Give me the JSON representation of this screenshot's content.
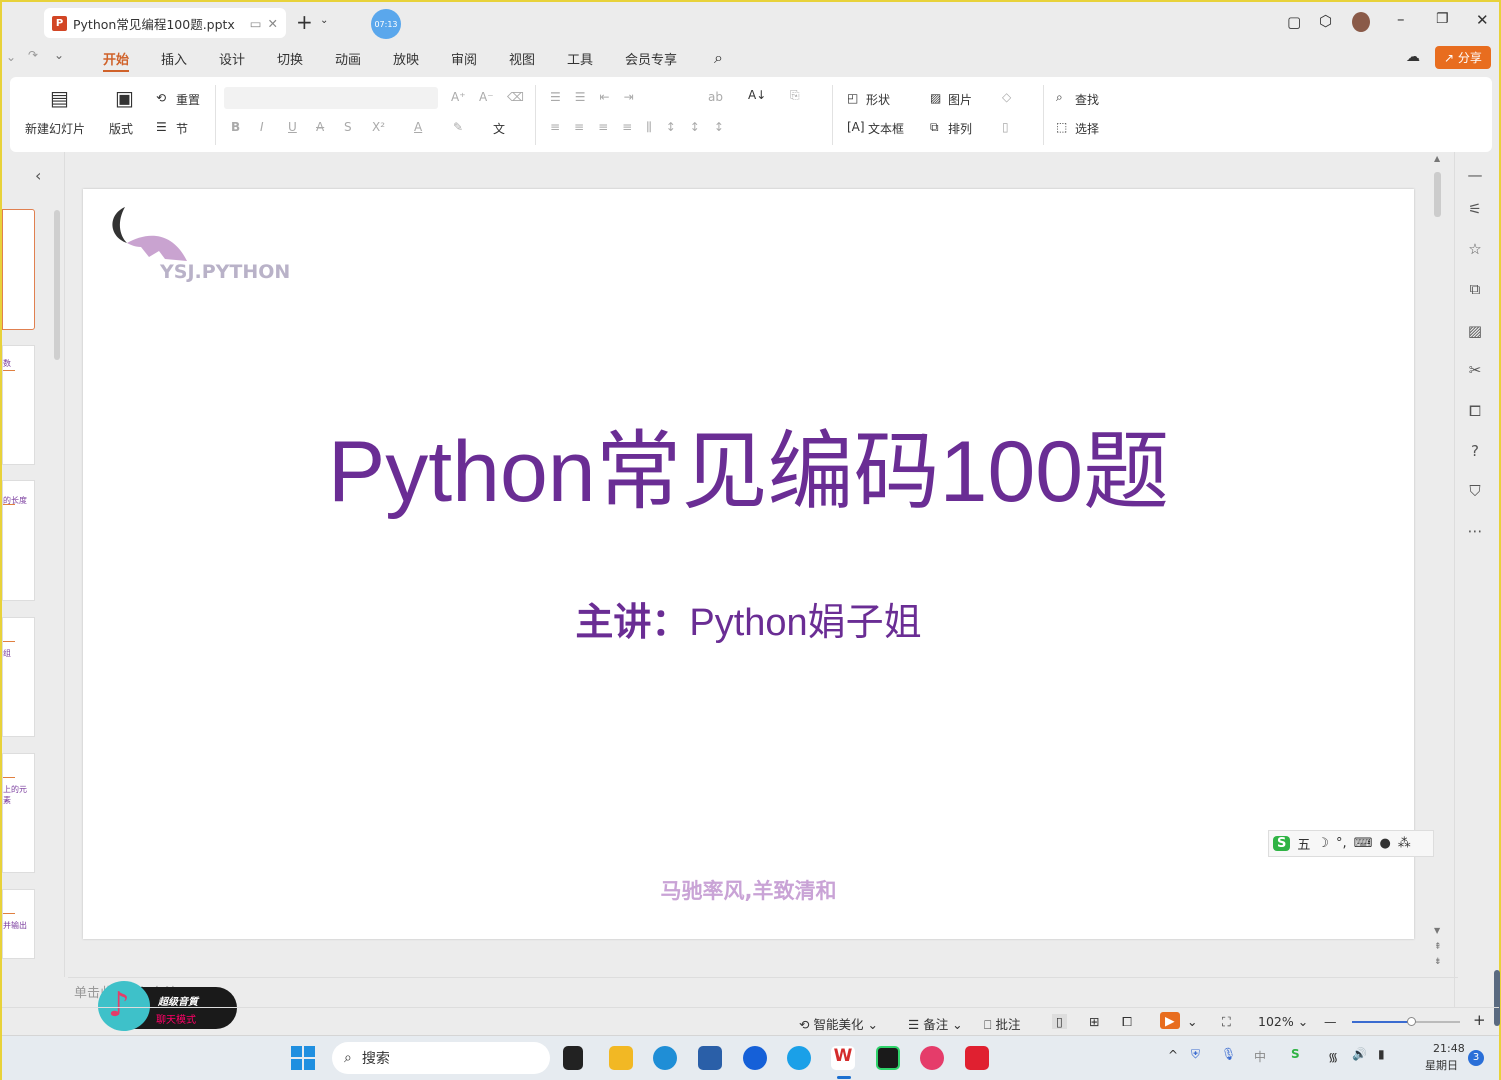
{
  "window": {
    "tab_title": "Python常见编程100题.pptx",
    "timer": "07:13",
    "new_tab": "+"
  },
  "menu": {
    "items": [
      "开始",
      "插入",
      "设计",
      "切换",
      "动画",
      "放映",
      "审阅",
      "视图",
      "工具",
      "会员专享"
    ],
    "active": "开始",
    "share_label": "分享"
  },
  "ribbon": {
    "new_slide": "新建幻灯片",
    "layout": "版式",
    "reset": "重置",
    "section": "节",
    "bold": "B",
    "italic": "I",
    "underline": "U",
    "superscript": "X²",
    "font_color": "A",
    "shape": "形状",
    "picture": "图片",
    "textbox": "文本框",
    "arrange": "排列",
    "find": "查找",
    "select": "选择"
  },
  "slide": {
    "logo_text": "YSJ.PYTHON",
    "title": "Python常见编码100题",
    "subtitle_label": "主讲：",
    "subtitle_name": "Python娟子姐",
    "motto": "马驰率风,羊致清和"
  },
  "thumbnails": [
    {
      "text": ""
    },
    {
      "text": "数"
    },
    {
      "text": "的长度"
    },
    {
      "text": "组"
    },
    {
      "text": "上的元素"
    },
    {
      "text": "并输出"
    }
  ],
  "notes": {
    "placeholder": "单击此处添加备注"
  },
  "status": {
    "beautify": "智能美化",
    "notes": "备注",
    "comments": "批注",
    "zoom": "102%",
    "zoom_level": 0.55
  },
  "ime": {
    "label": "五"
  },
  "music_widget": {
    "title": "超级音質",
    "mode": "聊天模式"
  },
  "taskbar": {
    "search_placeholder": "搜索",
    "time": "21:48",
    "day": "星期日",
    "notification_count": "3",
    "tray_ime": "中"
  },
  "colors": {
    "accent": "#d0622a",
    "share": "#e86d1f",
    "title": "#6a2d94",
    "motto": "#c9a3d6"
  }
}
